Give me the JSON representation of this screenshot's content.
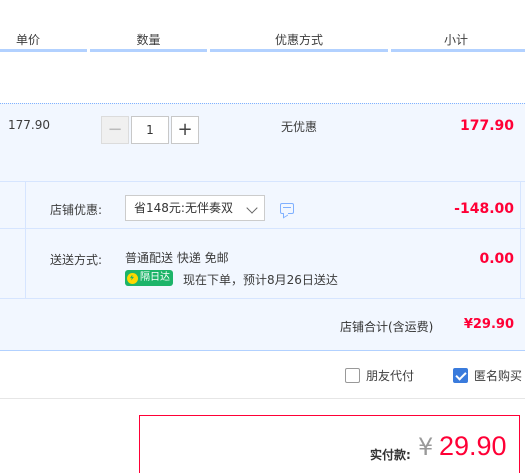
{
  "header": {
    "unit_price": "单价",
    "quantity": "数量",
    "promotion": "优惠方式",
    "subtotal": "小计"
  },
  "item": {
    "price": "177.90",
    "quantity": "1",
    "minus": "−",
    "plus": "+",
    "promotion": "无优惠",
    "subtotal": "177.90"
  },
  "shop": {
    "discount_label": "店铺优惠:",
    "discount_option": "省148元:无伴奏双",
    "discount_amount": "-148.00",
    "shipping_label": "送送方式:",
    "shipping_method": "普通配送 快递 免邮",
    "shipping_badge": "隔日达",
    "shipping_eta": "现在下单，预计8月26日送达",
    "shipping_amount": "0.00",
    "total_label": "店铺合计(含运费)",
    "total_value": "¥29.90"
  },
  "options": {
    "friend_pay": "朋友代付",
    "friend_pay_checked": false,
    "anonymous": "匿名购买",
    "anonymous_checked": true
  },
  "payment": {
    "label": "实付款:",
    "currency": "¥",
    "amount": "29.90"
  },
  "colors": {
    "accent_red": "#ff0036",
    "header_border": "#b2d1ff",
    "row_bg": "#f2f7ff",
    "badge_green": "#1db469"
  }
}
